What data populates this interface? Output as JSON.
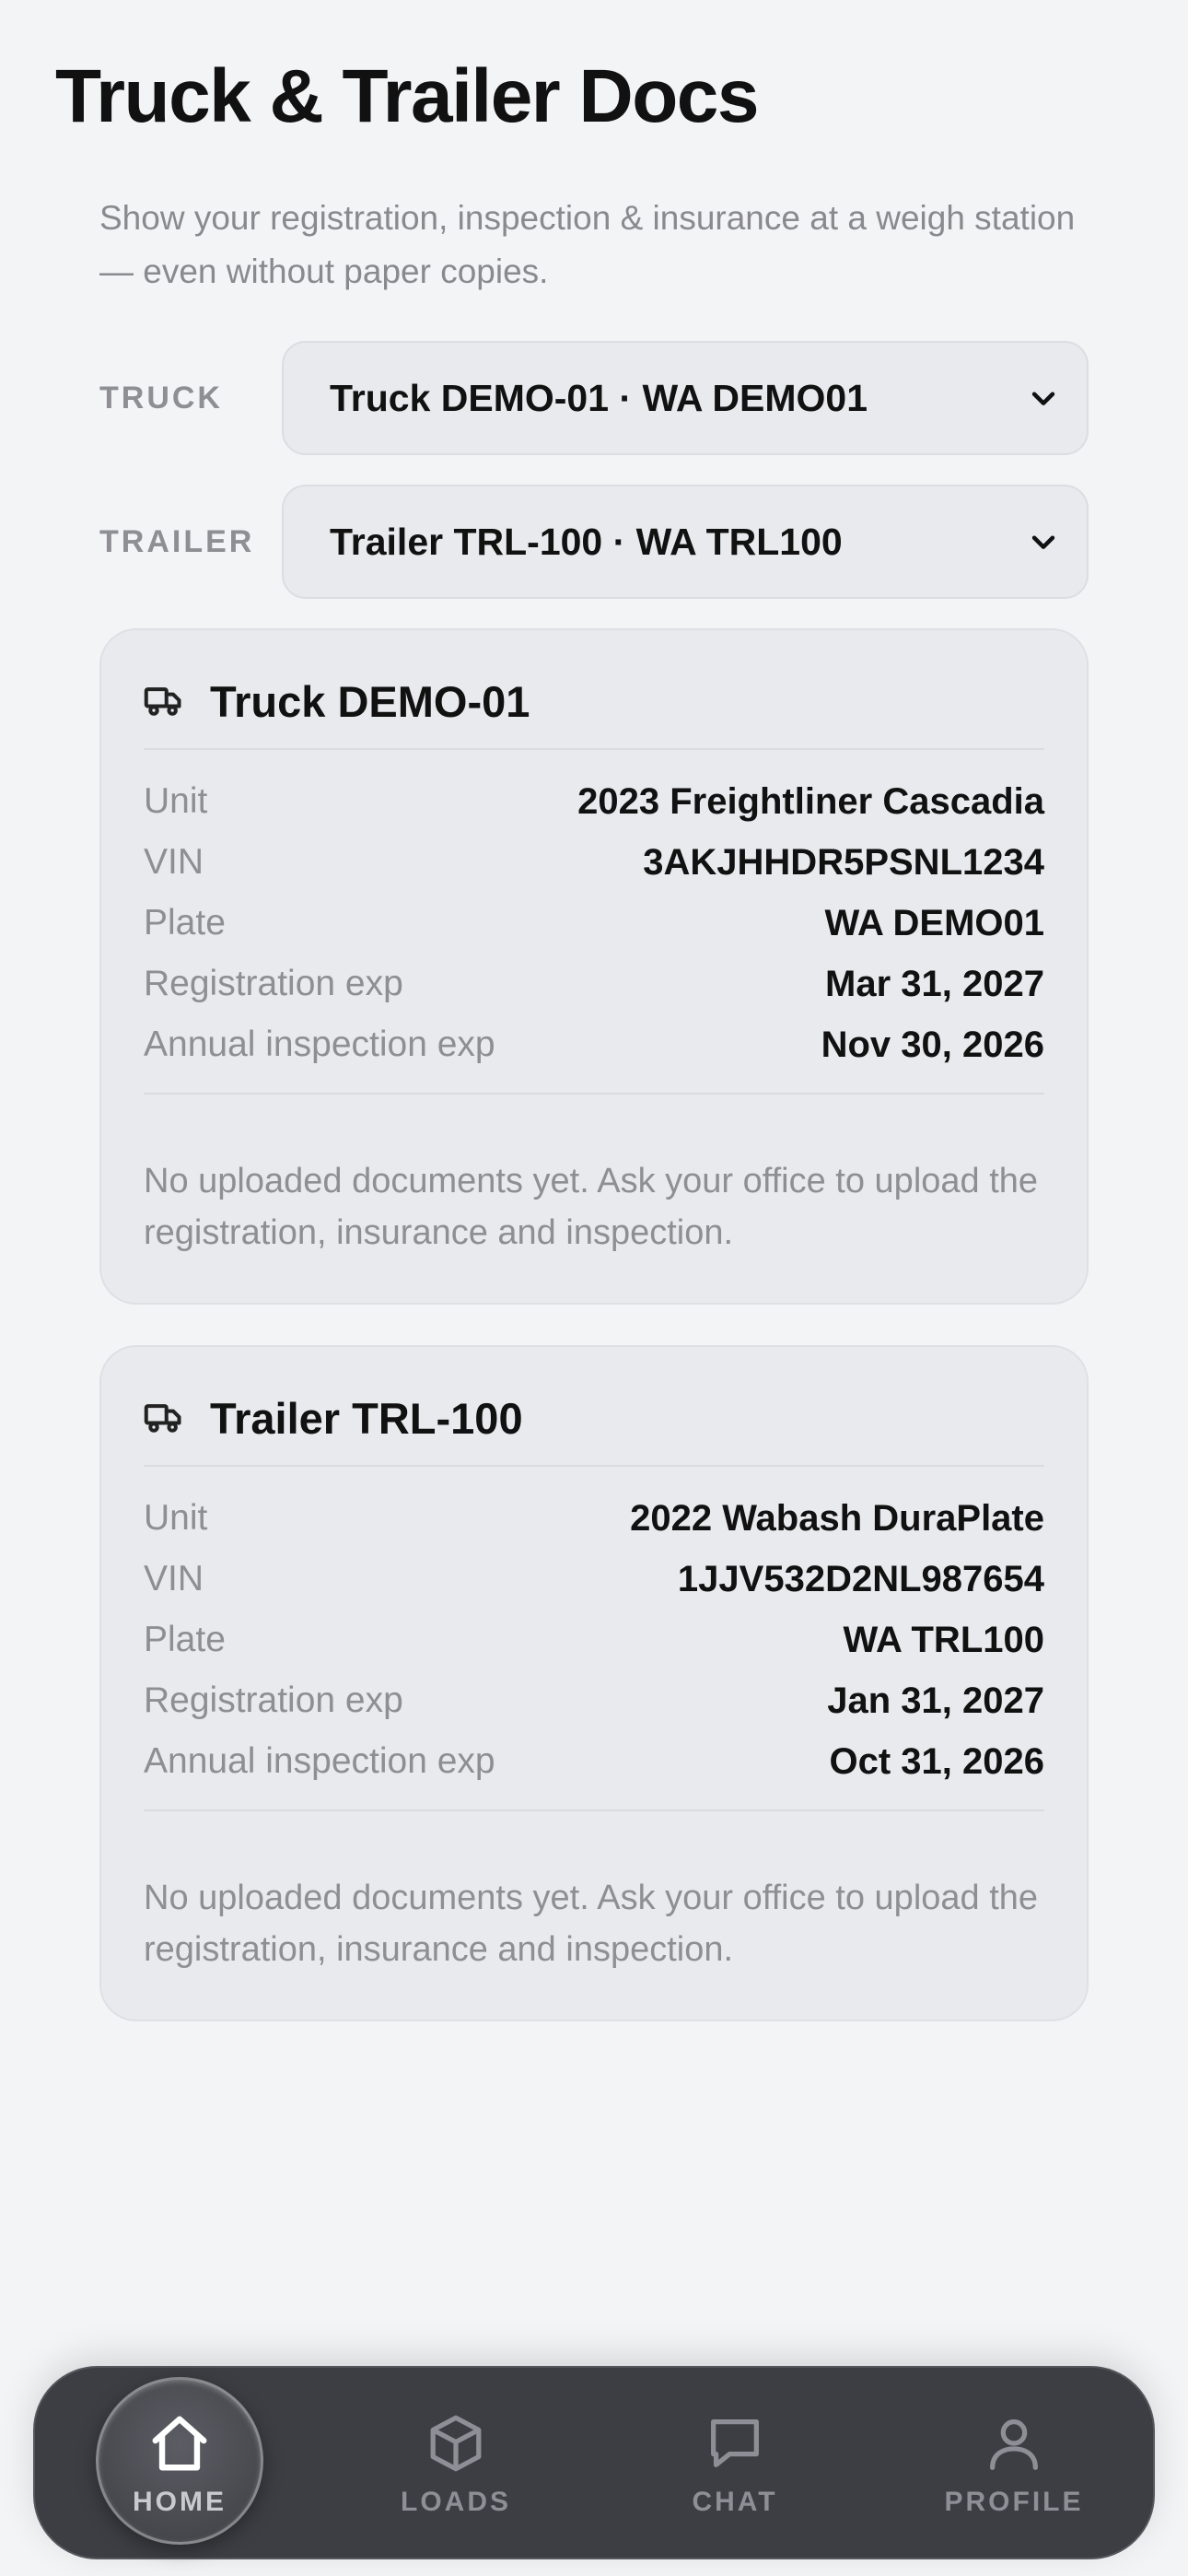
{
  "page": {
    "title": "Truck & Trailer Docs",
    "subtitle": "Show your registration, inspection & insurance at a weigh station — even without paper copies."
  },
  "selectors": {
    "truck": {
      "label": "TRUCK",
      "value": "Truck DEMO-01 · WA DEMO01",
      "icon": "chevron-down-icon"
    },
    "trailer": {
      "label": "TRAILER",
      "value": "Trailer TRL-100 · WA TRL100",
      "icon": "chevron-down-icon"
    }
  },
  "cards": {
    "truck": {
      "icon": "truck-icon",
      "title": "Truck DEMO-01",
      "rows": [
        {
          "label": "Unit",
          "value": "2023 Freightliner Cascadia"
        },
        {
          "label": "VIN",
          "value": "3AKJHHDR5PSNL1234"
        },
        {
          "label": "Plate",
          "value": "WA DEMO01"
        },
        {
          "label": "Registration exp",
          "value": "Mar 31, 2027"
        },
        {
          "label": "Annual inspection exp",
          "value": "Nov 30, 2026"
        }
      ],
      "note": "No uploaded documents yet. Ask your office to upload the registration, insurance and inspection."
    },
    "trailer": {
      "icon": "truck-icon",
      "title": "Trailer TRL-100",
      "rows": [
        {
          "label": "Unit",
          "value": "2022 Wabash DuraPlate"
        },
        {
          "label": "VIN",
          "value": "1JJV532D2NL987654"
        },
        {
          "label": "Plate",
          "value": "WA TRL100"
        },
        {
          "label": "Registration exp",
          "value": "Jan 31, 2027"
        },
        {
          "label": "Annual inspection exp",
          "value": "Oct 31, 2026"
        }
      ],
      "note": "No uploaded documents yet. Ask your office to upload the registration, insurance and inspection."
    }
  },
  "tabbar": {
    "active": "home",
    "items": [
      {
        "id": "home",
        "label": "HOME",
        "icon": "home-icon"
      },
      {
        "id": "loads",
        "label": "LOADS",
        "icon": "box-icon"
      },
      {
        "id": "chat",
        "label": "CHAT",
        "icon": "chat-bubble-icon"
      },
      {
        "id": "profile",
        "label": "PROFILE",
        "icon": "person-icon"
      }
    ]
  }
}
